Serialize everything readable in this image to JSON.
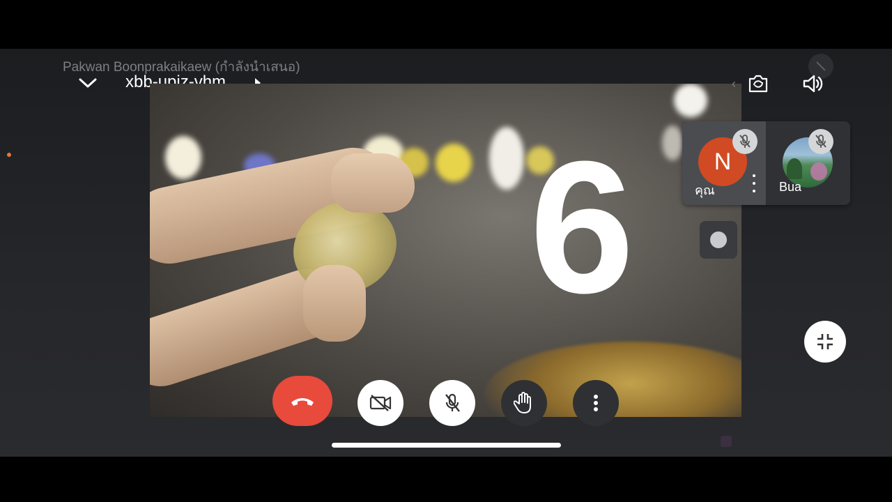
{
  "header": {
    "presenter_label": "Pakwan Boonprakaikaew (กำลังนำเสนอ)",
    "meeting_code": "xbb-upjz-vhm"
  },
  "stage": {
    "countdown_text": "6"
  },
  "participants": [
    {
      "initial": "N",
      "name": "คุณ",
      "avatar_color": "#d04a24",
      "muted": true
    },
    {
      "name": "Bua",
      "muted": true
    }
  ],
  "controls": {
    "end_call": {
      "icon": "hang-up-icon",
      "color": "#e84a3c"
    },
    "camera": {
      "icon": "camera-off-icon",
      "state": "off"
    },
    "mic": {
      "icon": "mic-off-icon",
      "state": "off"
    },
    "raise_hand": {
      "icon": "hand-icon"
    },
    "more": {
      "icon": "more-vertical-icon"
    }
  },
  "top_right": {
    "switch_camera_icon": "camera-switch-icon",
    "audio_output_icon": "speaker-icon"
  },
  "exit_fullscreen_icon": "exit-fullscreen-icon"
}
